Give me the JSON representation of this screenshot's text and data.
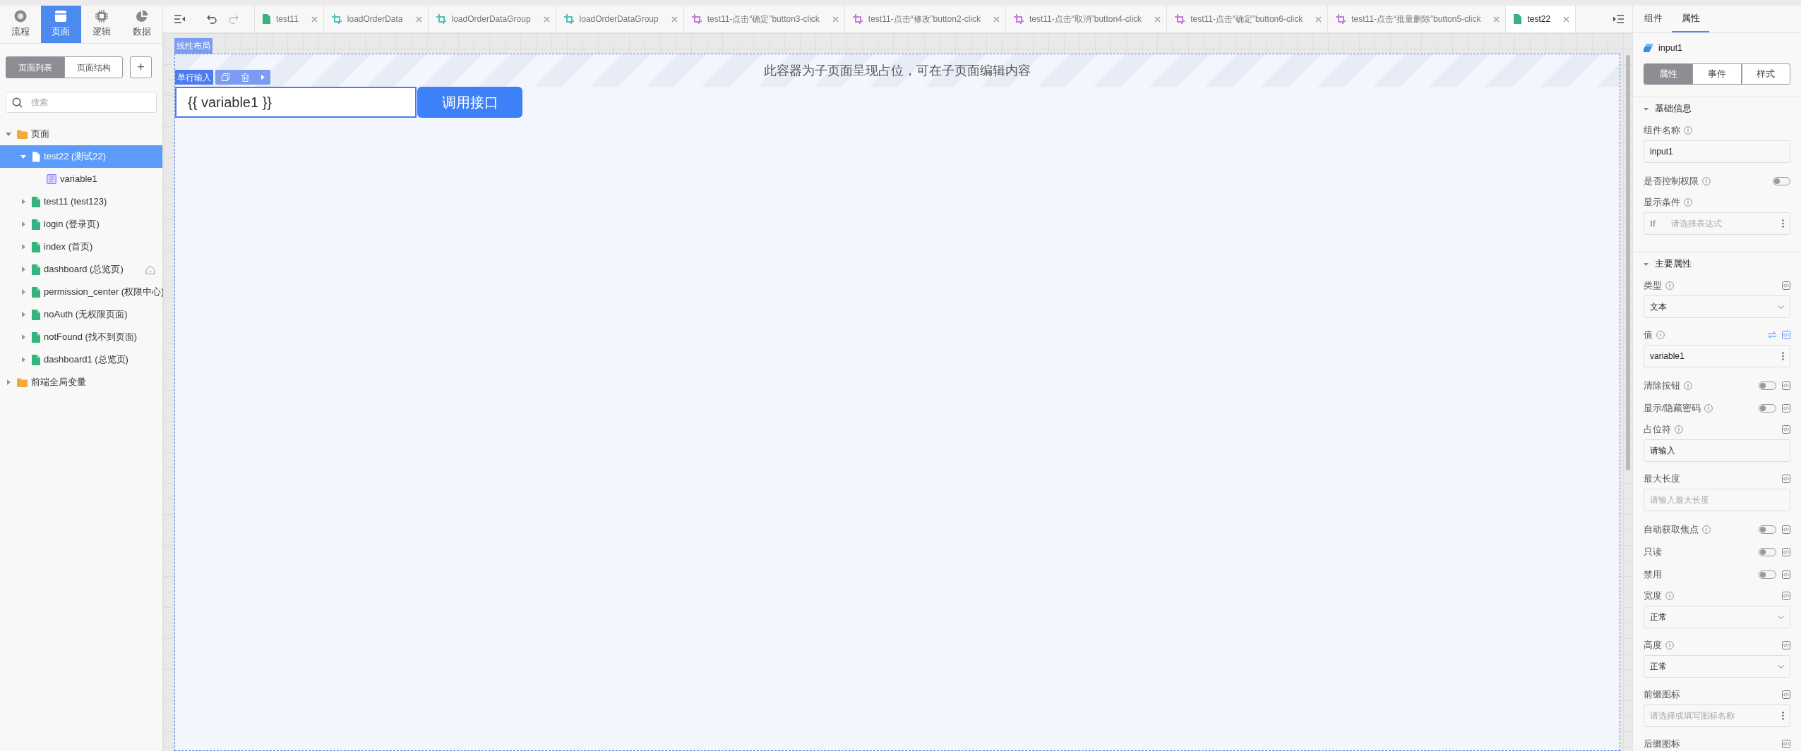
{
  "top_nav": [
    {
      "label": "流程",
      "selected": false
    },
    {
      "label": "页面",
      "selected": true
    },
    {
      "label": "逻辑",
      "selected": false
    },
    {
      "label": "数据",
      "selected": false
    }
  ],
  "sidebar": {
    "view_tabs": [
      {
        "label": "页面列表",
        "selected": true
      },
      {
        "label": "页面结构",
        "selected": false
      }
    ],
    "add_button": "+",
    "search": {
      "placeholder": "搜索"
    },
    "tree": [
      {
        "label": "页面",
        "kind": "folder",
        "expanded": true,
        "selected": false,
        "children": [
          {
            "label": "test22 (测试22)",
            "kind": "page",
            "expanded": true,
            "selected": true,
            "home": false,
            "children": [
              {
                "label": "variable1",
                "kind": "variable",
                "selected": false
              }
            ]
          },
          {
            "label": "test11 (test123)",
            "kind": "page",
            "expanded": false,
            "selected": false,
            "home": false
          },
          {
            "label": "login (登录页)",
            "kind": "page",
            "expanded": false,
            "selected": false,
            "home": false
          },
          {
            "label": "index (首页)",
            "kind": "page",
            "expanded": false,
            "selected": false,
            "home": false
          },
          {
            "label": "dashboard (总览页)",
            "kind": "page",
            "expanded": false,
            "selected": false,
            "home": true
          },
          {
            "label": "permission_center (权限中心)",
            "kind": "page",
            "expanded": false,
            "selected": false,
            "home": false
          },
          {
            "label": "noAuth (无权限页面)",
            "kind": "page",
            "expanded": false,
            "selected": false,
            "home": false
          },
          {
            "label": "notFound (找不到页面)",
            "kind": "page",
            "expanded": false,
            "selected": false,
            "home": false
          },
          {
            "label": "dashboard1 (总览页)",
            "kind": "page",
            "expanded": false,
            "selected": false,
            "home": false
          }
        ]
      },
      {
        "label": "前端全局变量",
        "kind": "folder",
        "expanded": false,
        "selected": false
      }
    ]
  },
  "editor_tabs": [
    {
      "label": "test11",
      "kind": "page",
      "color": "#36b37e",
      "selected": false
    },
    {
      "label": "loadOrderData",
      "kind": "logic",
      "color": "#4fc1b8",
      "selected": false
    },
    {
      "label": "loadOrderDataGroup",
      "kind": "logic",
      "color": "#4fc1b8",
      "selected": false
    },
    {
      "label": "loadOrderDataGroup",
      "kind": "logic",
      "color": "#4fc1b8",
      "selected": false
    },
    {
      "label": "test11-点击“确定”button3-click",
      "kind": "logic",
      "color": "#c27be0",
      "selected": false
    },
    {
      "label": "test11-点击“修改”button2-click",
      "kind": "logic",
      "color": "#c27be0",
      "selected": false
    },
    {
      "label": "test11-点击“取消”button4-click",
      "kind": "logic",
      "color": "#c27be0",
      "selected": false
    },
    {
      "label": "test11-点击“确定”button6-click",
      "kind": "logic",
      "color": "#c27be0",
      "selected": false
    },
    {
      "label": "test11-点击“批量删除”button5-click",
      "kind": "logic",
      "color": "#c27be0",
      "selected": false
    },
    {
      "label": "test22",
      "kind": "page",
      "color": "#36b37e",
      "selected": true
    }
  ],
  "canvas": {
    "layout_label": "线性布局",
    "placeholder_text": "此容器为子页面呈现占位，可在子页面编辑内容",
    "selected_label": "单行输入",
    "input_value": "{{ variable1 }}",
    "button": "调用接口"
  },
  "panel": {
    "tabs": [
      {
        "label": "组件",
        "selected": false
      },
      {
        "label": "属性",
        "selected": true
      }
    ],
    "component": "input1",
    "subtabs": [
      {
        "label": "属性",
        "selected": true
      },
      {
        "label": "事件",
        "selected": false
      },
      {
        "label": "样式",
        "selected": false
      }
    ],
    "sections": [
      {
        "title": "基础信息",
        "expanded": true,
        "items": [
          {
            "kind": "input",
            "label": "组件名称",
            "info": true,
            "value": "input1",
            "menu": false
          },
          {
            "kind": "toggle",
            "label": "是否控制权限",
            "info": true,
            "on": false
          },
          {
            "kind": "input",
            "label": "显示条件",
            "info": true,
            "prefix": "If",
            "placeholder": "请选择表达式",
            "menu": true
          }
        ]
      },
      {
        "title": "主要属性",
        "expanded": true,
        "items": [
          {
            "kind": "select",
            "label": "类型",
            "info": true,
            "bound": false,
            "value": "文本"
          },
          {
            "kind": "input",
            "label": "值",
            "info": true,
            "bound": true,
            "value": "variable1",
            "menu": true
          },
          {
            "kind": "toggle",
            "label": "清除按钮",
            "info": true,
            "on": false,
            "bound": false
          },
          {
            "kind": "toggle",
            "label": "显示/隐藏密码",
            "info": true,
            "on": false,
            "bound": false
          },
          {
            "kind": "input",
            "label": "占位符",
            "info": true,
            "bound": false,
            "value": "请输入",
            "menu": false
          },
          {
            "kind": "input",
            "label": "最大长度",
            "info": false,
            "bound": false,
            "placeholder": "请输入最大长度",
            "menu": false
          },
          {
            "kind": "toggle",
            "label": "自动获取焦点",
            "info": true,
            "on": false,
            "bound": false
          },
          {
            "kind": "toggle",
            "label": "只读",
            "info": false,
            "on": false,
            "bound": false
          },
          {
            "kind": "toggle",
            "label": "禁用",
            "info": false,
            "on": false,
            "bound": false
          },
          {
            "kind": "select",
            "label": "宽度",
            "info": true,
            "bound": false,
            "value": "正常"
          },
          {
            "kind": "select",
            "label": "高度",
            "info": true,
            "bound": false,
            "value": "正常"
          },
          {
            "kind": "input",
            "label": "前缀图标",
            "info": false,
            "bound": false,
            "placeholder": "请选择或填写图标名称",
            "menu": true
          },
          {
            "kind": "label",
            "label": "后缀图标",
            "info": false,
            "bound": false
          }
        ]
      }
    ]
  }
}
